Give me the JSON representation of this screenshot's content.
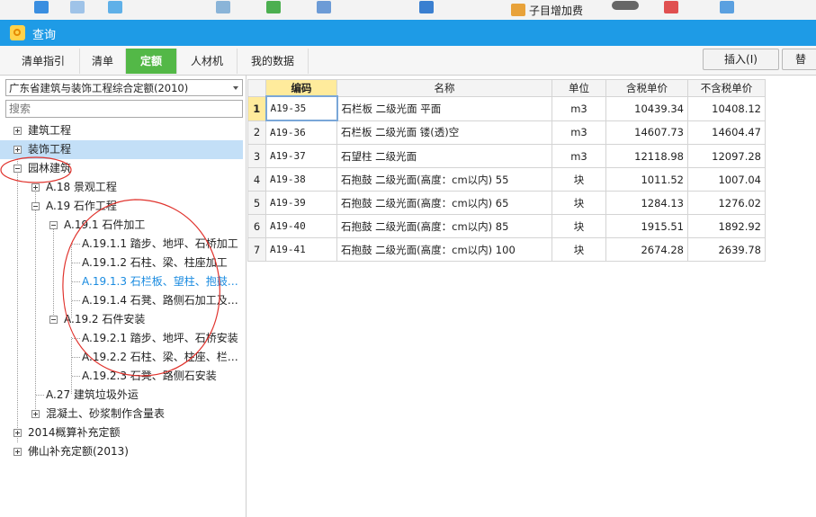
{
  "toolbar": {
    "subitem_fee_label": "子目增加费"
  },
  "window": {
    "title": "查询"
  },
  "tabs": [
    {
      "label": "清单指引"
    },
    {
      "label": "清单"
    },
    {
      "label": "定额"
    },
    {
      "label": "人材机"
    },
    {
      "label": "我的数据"
    }
  ],
  "actions": {
    "insert_label": "插入(I)",
    "replace_label": "替"
  },
  "left": {
    "dropdown_value": "广东省建筑与装饰工程综合定额(2010)",
    "search_placeholder": "搜索",
    "tree": [
      {
        "label": "建筑工程"
      },
      {
        "label": "装饰工程"
      },
      {
        "label": "园林建筑"
      },
      {
        "label": "A.18 景观工程"
      },
      {
        "label": "A.19 石作工程"
      },
      {
        "label": "A.19.1 石件加工"
      },
      {
        "label": "A.19.1.1 踏步、地坪、石桥加工"
      },
      {
        "label": "A.19.1.2 石柱、梁、柱座加工"
      },
      {
        "label": "A.19.1.3 石栏板、望柱、抱鼓…"
      },
      {
        "label": "A.19.1.4 石凳、路侧石加工及…"
      },
      {
        "label": "A.19.2 石件安装"
      },
      {
        "label": "A.19.2.1 踏步、地坪、石桥安装"
      },
      {
        "label": "A.19.2.2 石柱、梁、柱座、栏…"
      },
      {
        "label": "A.19.2.3 石凳、路侧石安装"
      },
      {
        "label": "A.27 建筑垃圾外运"
      },
      {
        "label": "混凝土、砂浆制作含量表"
      },
      {
        "label": "2014概算补充定额"
      },
      {
        "label": "佛山补充定额(2013)"
      }
    ]
  },
  "grid": {
    "columns": [
      "编码",
      "名称",
      "单位",
      "含税单价",
      "不含税单价"
    ],
    "rows": [
      {
        "n": "1",
        "code": "A19-35",
        "name": "石栏板 二级光面 平面",
        "unit": "m3",
        "price_tax": "10439.34",
        "price_notax": "10408.12"
      },
      {
        "n": "2",
        "code": "A19-36",
        "name": "石栏板 二级光面 镂(透)空",
        "unit": "m3",
        "price_tax": "14607.73",
        "price_notax": "14604.47"
      },
      {
        "n": "3",
        "code": "A19-37",
        "name": "石望柱 二级光面",
        "unit": "m3",
        "price_tax": "12118.98",
        "price_notax": "12097.28"
      },
      {
        "n": "4",
        "code": "A19-38",
        "name": "石抱鼓 二级光面(高度：cm以内) 55",
        "unit": "块",
        "price_tax": "1011.52",
        "price_notax": "1007.04"
      },
      {
        "n": "5",
        "code": "A19-39",
        "name": "石抱鼓 二级光面(高度：cm以内) 65",
        "unit": "块",
        "price_tax": "1284.13",
        "price_notax": "1276.02"
      },
      {
        "n": "6",
        "code": "A19-40",
        "name": "石抱鼓 二级光面(高度：cm以内) 85",
        "unit": "块",
        "price_tax": "1915.51",
        "price_notax": "1892.92"
      },
      {
        "n": "7",
        "code": "A19-41",
        "name": "石抱鼓 二级光面(高度：cm以内) 100",
        "unit": "块",
        "price_tax": "2674.28",
        "price_notax": "2639.78"
      }
    ]
  },
  "colors": {
    "titlebar": "#1e9be6",
    "active_tab": "#53b847",
    "selected_row": "#c3dff7",
    "highlight_link": "#1a8be0",
    "annotation": "#e0322c"
  }
}
